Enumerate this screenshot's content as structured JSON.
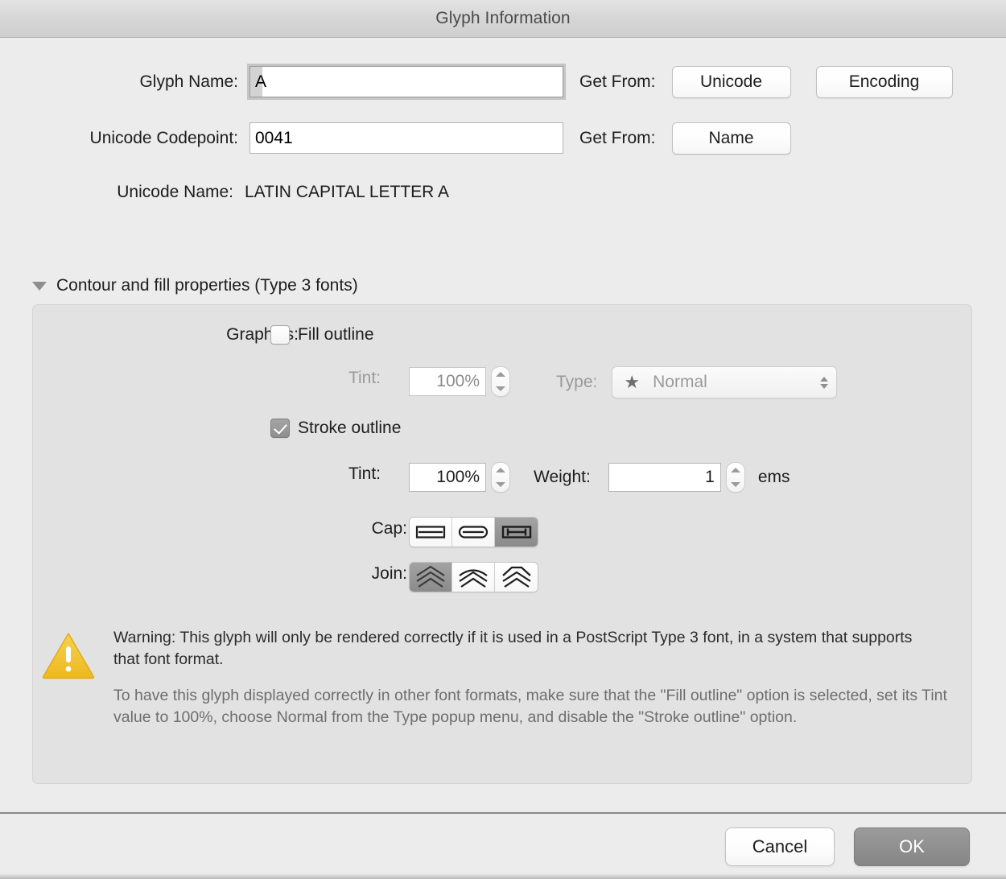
{
  "window": {
    "title": "Glyph Information"
  },
  "form": {
    "glyph_name_label": "Glyph Name:",
    "glyph_name_value": "A",
    "glyph_name_get_from_label": "Get From:",
    "get_from_unicode_button": "Unicode",
    "get_from_encoding_button": "Encoding",
    "codepoint_label": "Unicode Codepoint:",
    "codepoint_value": "0041",
    "codepoint_get_from_label": "Get From:",
    "get_from_name_button": "Name",
    "unicode_name_label": "Unicode Name:",
    "unicode_name_value": "LATIN CAPITAL LETTER A"
  },
  "disclosure": {
    "label": "Contour and fill properties (Type 3 fonts)",
    "expanded": true
  },
  "contour": {
    "graphics_label": "Graphics:",
    "fill_outline_label": "Fill outline",
    "fill_outline_checked": false,
    "fill_tint_label": "Tint:",
    "fill_tint_value": "100%",
    "type_label": "Type:",
    "type_value": "Normal",
    "type_icon": "star-icon",
    "stroke_outline_label": "Stroke outline",
    "stroke_outline_checked": true,
    "stroke_tint_label": "Tint:",
    "stroke_tint_value": "100%",
    "weight_label": "Weight:",
    "weight_value": "1",
    "weight_units": "ems",
    "cap_label": "Cap:",
    "cap_options": [
      "butt-cap",
      "round-cap",
      "projecting-cap"
    ],
    "cap_selected_index": 2,
    "join_label": "Join:",
    "join_options": [
      "miter-join",
      "round-join",
      "bevel-join"
    ],
    "join_selected_index": 0
  },
  "warning": {
    "icon": "warning-triangle-icon",
    "title": "Warning: This glyph will only be rendered correctly if it is used in a PostScript Type 3 font, in a system that supports that font format.",
    "body": "To have this glyph displayed correctly in other font formats, make sure that the \"Fill outline\" option is selected, set its Tint value to 100%, choose Normal from the Type popup menu, and disable the \"Stroke outline\" option."
  },
  "footer": {
    "cancel_label": "Cancel",
    "ok_label": "OK"
  },
  "colors": {
    "window_bg": "#ececec",
    "groupbox_bg": "#e2e2e2",
    "warning_yellow": "#f2c430",
    "selected_segment": "#8e8e8e",
    "default_button": "#8e8e8e"
  }
}
